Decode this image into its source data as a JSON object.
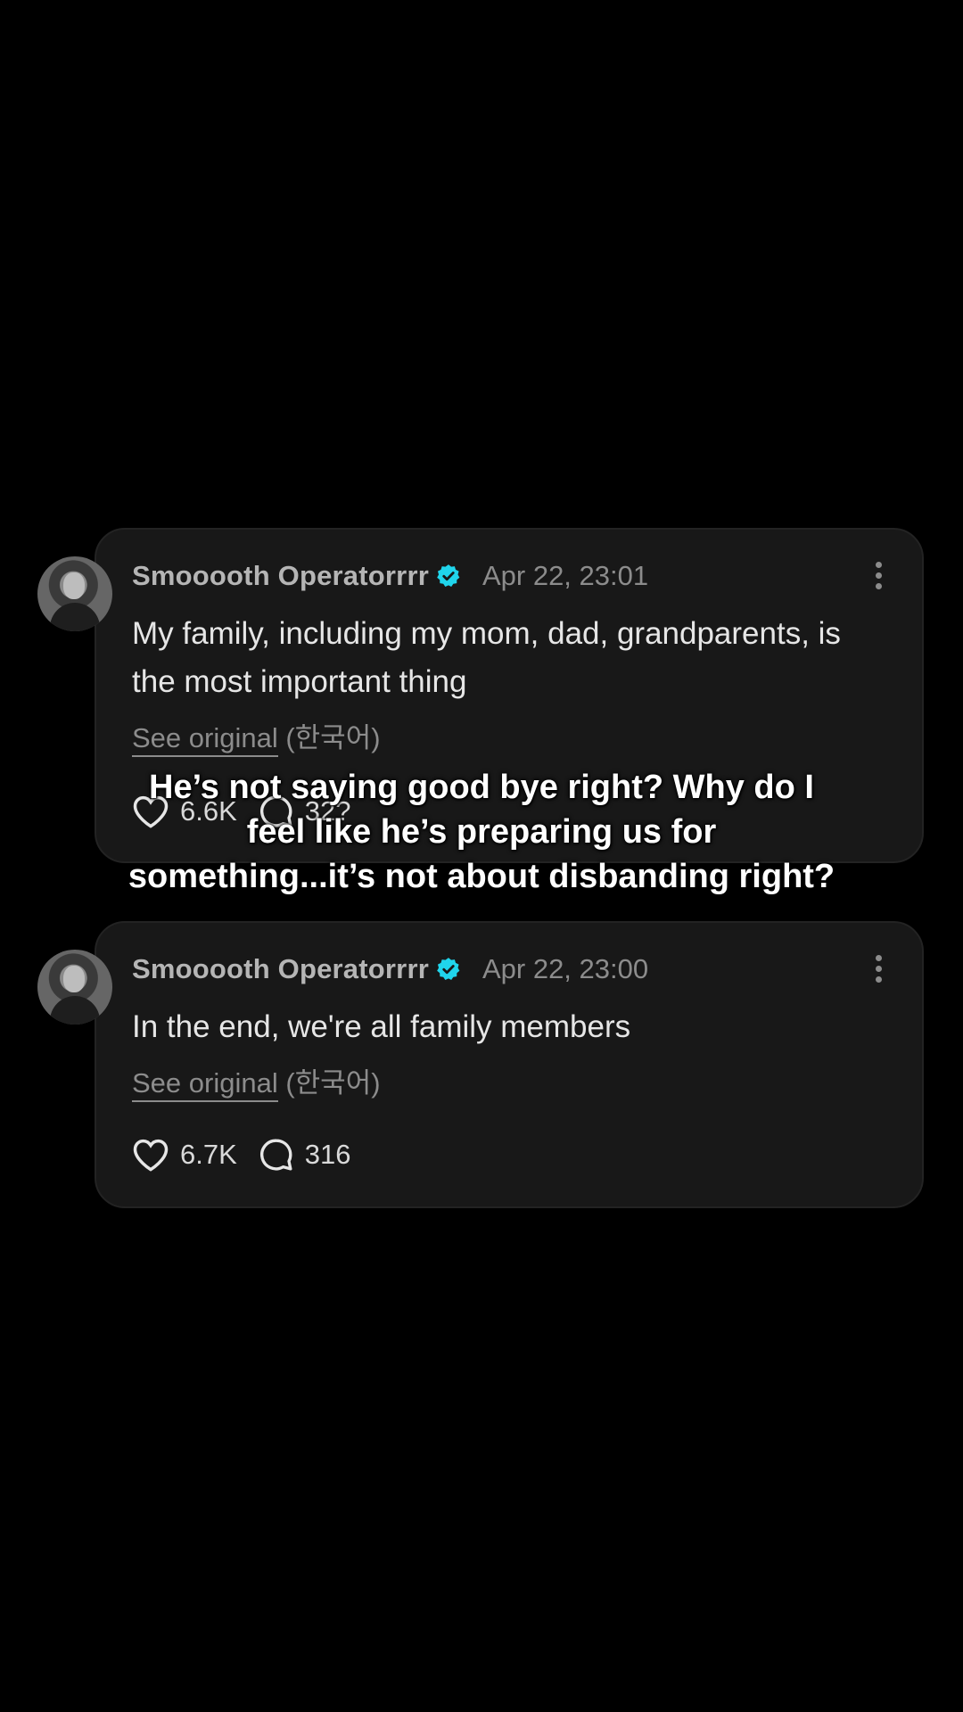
{
  "posts": [
    {
      "username": "Smooooth Operatorrrr",
      "timestamp": "Apr 22, 23:01",
      "text": "My family, including my mom, dad, grandparents, is the most important thing",
      "see_original": "See original",
      "language": "(한국어)",
      "likes": "6.6K",
      "comments": "32?"
    },
    {
      "username": "Smooooth Operatorrrr",
      "timestamp": "Apr 22, 23:00",
      "text": "In the end, we're all family members",
      "see_original": "See original",
      "language": "(한국어)",
      "likes": "6.7K",
      "comments": "316"
    }
  ],
  "caption": "He’s not saying good bye right? Why do I feel like he’s preparing us for something...it’s not about disbanding right?",
  "colors": {
    "verified": "#20d5ec",
    "card": "#181818",
    "background": "#000000"
  },
  "icons": [
    "verified-badge-icon",
    "more-options-icon",
    "heart-icon",
    "comment-icon"
  ]
}
